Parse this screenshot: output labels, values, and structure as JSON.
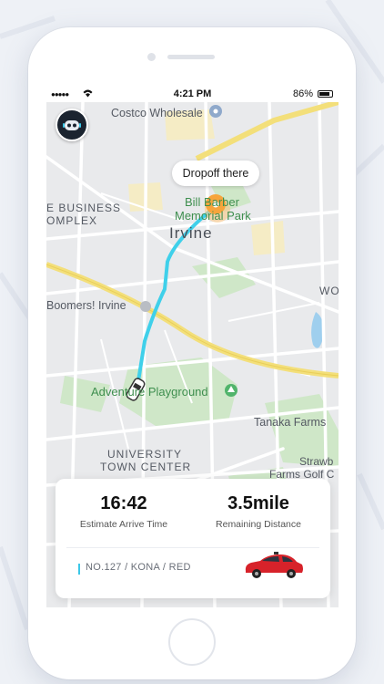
{
  "status_bar": {
    "time": "4:21 PM",
    "battery": "86%"
  },
  "map": {
    "places": {
      "costco": "Costco Wholesale",
      "business_1": "E BUSINESS",
      "business_2": "OMPLEX",
      "park_1": "Bill Barber",
      "park_2": "Memorial Park",
      "city": "Irvine",
      "boomers": "Boomers! Irvine",
      "wo": "WO",
      "playground": "Adventure Playground",
      "tanaka": "Tanaka Farms",
      "utc_1": "UNIVERSITY",
      "utc_2": "TOWN CENTER",
      "strawb": "Strawb",
      "golf": "Farms Golf C"
    },
    "colors": {
      "route": "#3fd0ea",
      "pin": "#f7a53c",
      "highway": "#f3df7a"
    }
  },
  "dropoff_label": "Dropoff there",
  "trip": {
    "arrive_time": "16:42",
    "arrive_label": "Estimate Arrive Time",
    "distance": "3.5mile",
    "distance_label": "Remaining Distance",
    "vehicle": "NO.127 / KONA / RED"
  }
}
